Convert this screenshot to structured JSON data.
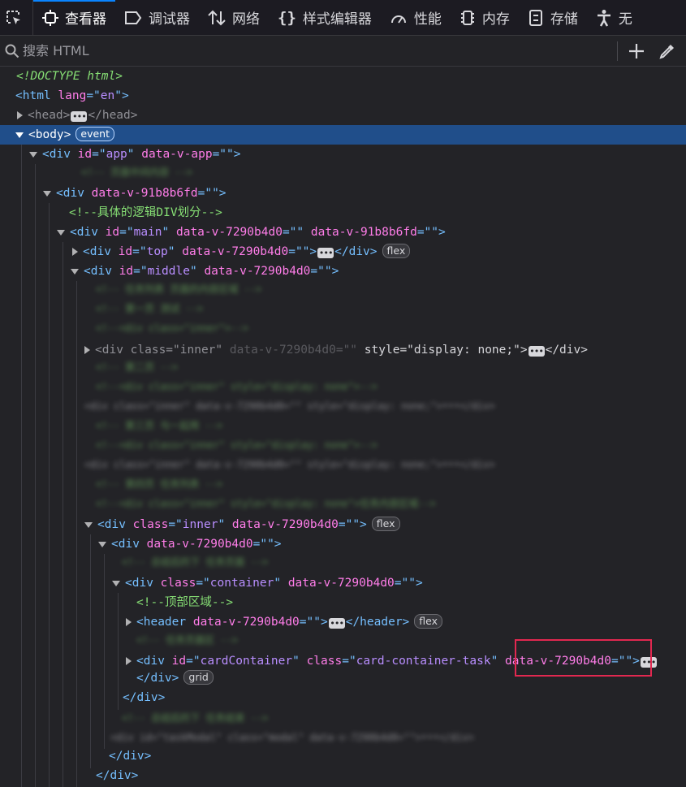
{
  "toolbar": {
    "tabs": [
      {
        "label": "查看器",
        "icon": "inspector-icon"
      },
      {
        "label": "调试器",
        "icon": "debugger-icon"
      },
      {
        "label": "网络",
        "icon": "network-icon"
      },
      {
        "label": "样式编辑器",
        "icon": "style-editor-icon"
      },
      {
        "label": "性能",
        "icon": "performance-icon"
      },
      {
        "label": "内存",
        "icon": "memory-icon"
      },
      {
        "label": "存储",
        "icon": "storage-icon"
      },
      {
        "label": "无",
        "icon": "accessibility-icon"
      }
    ],
    "active_tab": "查看器"
  },
  "search": {
    "placeholder": "搜索 HTML",
    "add_icon": "plus-icon",
    "picker_icon": "eyedropper-icon"
  },
  "tree": {
    "doctype": "<!DOCTYPE html>",
    "html_lang": "en",
    "comment_logic": "<!--具体的逻辑DIV划分-->",
    "comment_top": "<!--顶部区域-->",
    "attr_app": "data-v-app",
    "attr_91b": "data-v-91b8b6fd",
    "attr_729": "data-v-7290b4d0",
    "id_app": "app",
    "id_main": "main",
    "id_top": "top",
    "id_middle": "middle",
    "class_inner": "inner",
    "class_container": "container",
    "id_card": "cardContainer",
    "class_card": "card-container-task",
    "style_none": "display: none;",
    "badge_event": "event",
    "badge_flex": "flex",
    "badge_grid": "grid",
    "ellipsis": "•••",
    "blurred_lines": [
      "<!-- 页面中间内容 -->",
      "<!-- 任务列表 页面的内容区域 -->",
      "<!-- 第一页 测试 -->",
      "<!--<div class=\"inner\">-->",
      "<!-- 第二页 -->",
      "<!--<div class=\"inner\" style=\"display: none\">-->",
      "<div class=\"inner\" data-v-7290b4d0=\"\" style=\"display: none;\">•••</div>",
      "<!-- 第三页 与一起用 -->",
      "<!--<div class=\"inner\" style=\"display: none\">-->",
      "<div class=\"inner\" data-v-7290b4d0=\"\" style=\"display: none;\">•••</div>",
      "<!-- 第四页 任务列表 -->",
      "<!--<div class=\"inner\" style=\"display: none\">任务内容区域-->",
      "<!-- 总结后的下 任务页面 -->",
      "<!-- 任务页面区 -->",
      "<!-- 总结后的下 任务结束 -->",
      "<div id=\"taskModal\" class=\"modal\" data-v-7290b4d0=\"\">•••</div>"
    ]
  }
}
